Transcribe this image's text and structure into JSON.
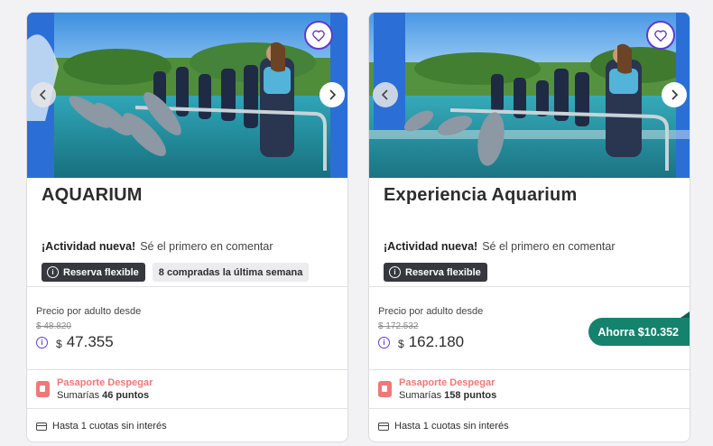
{
  "cards": [
    {
      "title": "AQUARIUM",
      "rating_title": "¡Actividad nueva!",
      "rating_sub": "Sé el primero en comentar",
      "tag_flexible": "Reserva flexible",
      "tag_bought": "8 compradas la última semana",
      "price_label": "Precio por adulto desde",
      "old_price": "$ 48.820",
      "currency": "$",
      "price": "47.355",
      "passport_name": "Pasaporte Despegar",
      "passport_prefix": "Sumarías",
      "passport_points": "46 puntos",
      "installments": "Hasta 1 cuotas sin interés"
    },
    {
      "title": "Experiencia Aquarium",
      "rating_title": "¡Actividad nueva!",
      "rating_sub": "Sé el primero en comentar",
      "tag_flexible": "Reserva flexible",
      "price_label": "Precio por adulto desde",
      "old_price": "$ 172.532",
      "currency": "$",
      "price": "162.180",
      "savings": "Ahorra $10.352",
      "passport_name": "Pasaporte Despegar",
      "passport_prefix": "Sumarías",
      "passport_points": "158 puntos",
      "installments": "Hasta 1 cuotas sin interés"
    }
  ],
  "icons": {
    "favorite": "heart-icon",
    "prev": "chevron-left-icon",
    "next": "chevron-right-icon",
    "info": "info-icon",
    "passport": "passport-icon",
    "payment": "credit-card-icon"
  },
  "colors": {
    "brand_purple": "#5c3bd1",
    "savings_green": "#15826d",
    "passport_red": "#f07878",
    "tag_dark": "#37383e"
  }
}
